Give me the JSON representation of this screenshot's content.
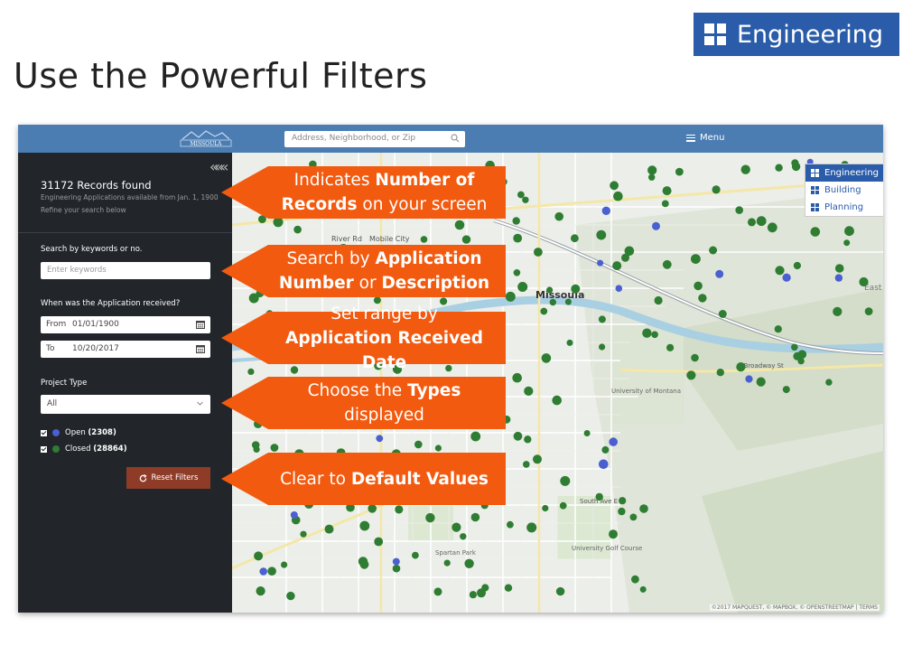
{
  "badge": {
    "label": "Engineering"
  },
  "slide_title": "Use the Powerful Filters",
  "app": {
    "logo_text": "MISSOULA",
    "search_placeholder": "Address, Neighborhood, or Zip",
    "menu_label": "Menu",
    "sidebar": {
      "collapse_glyph": "«««",
      "records_found": "31172 Records found",
      "records_sub": "Engineering Applications available from Jan. 1, 1900",
      "refine": "Refine your search below",
      "keyword_label": "Search by keywords or no.",
      "keyword_placeholder": "Enter keywords",
      "received_label": "When was the Application received?",
      "from_prefix": "From",
      "from_value": "01/01/1900",
      "to_prefix": "To",
      "to_value": "10/20/2017",
      "project_type_label": "Project Type",
      "project_type_value": "All",
      "open_label": "Open",
      "open_count": "(2308)",
      "closed_label": "Closed",
      "closed_count": "(28864)",
      "reset_label": "Reset Filters"
    },
    "layers": [
      {
        "label": "Engineering",
        "active": true
      },
      {
        "label": "Building",
        "active": false
      },
      {
        "label": "Planning",
        "active": false
      }
    ],
    "map_labels": {
      "missoula": "Missoula",
      "river_rd": "River Rd",
      "mobile_city": "Mobile City",
      "university": "University of Montana",
      "golf": "University Golf Course",
      "spartan": "Spartan Park",
      "broadway": "E Broadway St",
      "south_ave": "South Ave E",
      "east": "East"
    },
    "attribution": "©2017 MAPQUEST, © MAPBOX, © OPENSTREETMAP | TERMS"
  },
  "callouts": [
    {
      "pre": "Indicates ",
      "bold": "Number of",
      "line2_bold": "Records",
      "line2_rest": " on your screen"
    },
    {
      "pre": "Search by ",
      "bold": "Application",
      "line2_bold": "Number",
      "line2_mid": " or ",
      "line2_bold2": "Description"
    },
    {
      "line1": "Set range by",
      "line2_bold": "Application Received Date"
    },
    {
      "pre": "Choose the ",
      "bold": "Types",
      "post": " displayed"
    },
    {
      "pre": "Clear to ",
      "bold": "Default Values"
    }
  ],
  "colors": {
    "badge_blue": "#2a5caa",
    "callout_orange": "#f25a0f",
    "open_dot": "#4a5fd0",
    "closed_dot": "#2e7d32",
    "reset_button": "#8e3c28"
  }
}
